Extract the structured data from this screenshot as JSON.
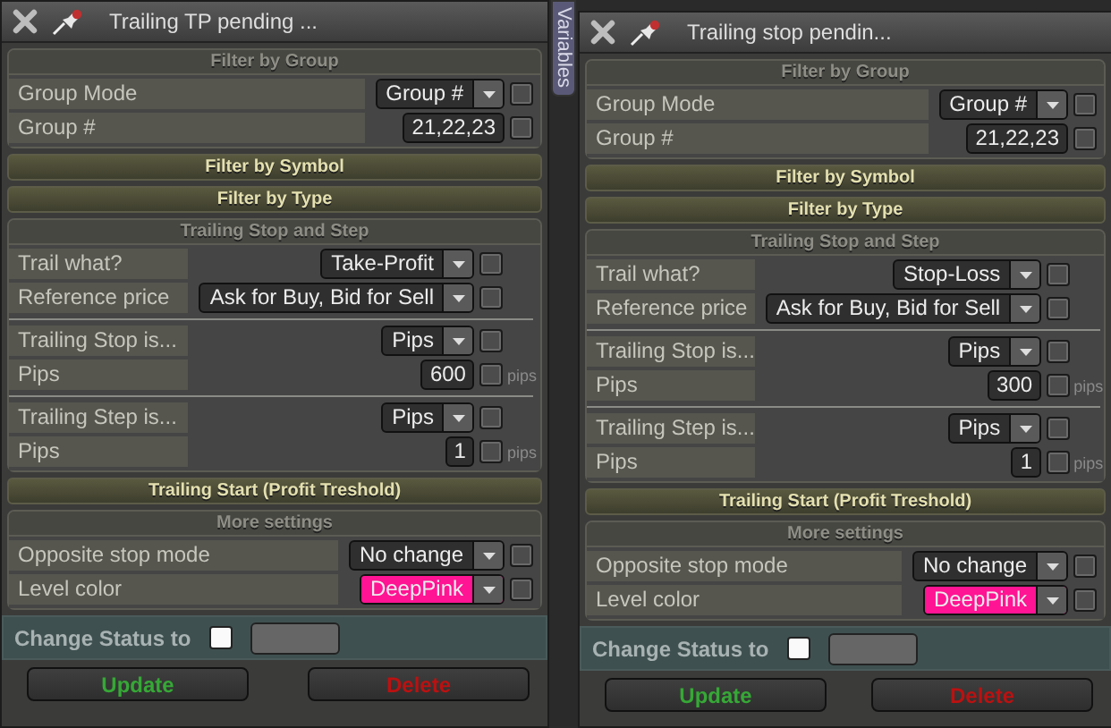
{
  "panels": [
    {
      "title": "Trailing TP pending ...",
      "sections": [
        {
          "title": "Filter by Group",
          "expanded": true,
          "groups": [
            {
              "rows": [
                {
                  "label": "Group Mode",
                  "kind": "dropdown",
                  "value": "Group #",
                  "checked": false
                },
                {
                  "label": "Group #",
                  "kind": "number",
                  "value": "21,22,23",
                  "checked": false
                }
              ]
            }
          ]
        },
        {
          "title": "Filter by Symbol",
          "expanded": false
        },
        {
          "title": "Filter by Type",
          "expanded": false
        },
        {
          "title": "Trailing Stop and Step",
          "expanded": true,
          "groups": [
            {
              "rows": [
                {
                  "label": "Trail what?",
                  "kind": "dropdown",
                  "value": "Take-Profit",
                  "checked": false
                },
                {
                  "label": "Reference price",
                  "kind": "dropdown",
                  "value": "Ask for Buy, Bid for Sell",
                  "checked": false
                }
              ]
            },
            {
              "rows": [
                {
                  "label": "Trailing Stop is...",
                  "kind": "dropdown",
                  "value": "Pips",
                  "checked": false
                },
                {
                  "label": "Pips",
                  "kind": "number",
                  "value": "600",
                  "checked": false,
                  "unit": "pips"
                }
              ]
            },
            {
              "rows": [
                {
                  "label": "Trailing Step is...",
                  "kind": "dropdown",
                  "value": "Pips",
                  "checked": false
                },
                {
                  "label": "Pips",
                  "kind": "number",
                  "value": "1",
                  "checked": false,
                  "unit": "pips"
                }
              ]
            }
          ]
        },
        {
          "title": "Trailing Start (Profit Treshold)",
          "expanded": false
        },
        {
          "title": "More settings",
          "expanded": true,
          "groups": [
            {
              "rows": [
                {
                  "label": "Opposite stop mode",
                  "kind": "dropdown",
                  "value": "No change",
                  "checked": false
                },
                {
                  "label": "Level color",
                  "kind": "dropdown",
                  "value": "DeepPink",
                  "checked": false,
                  "color": "#ff1493"
                }
              ]
            }
          ]
        }
      ],
      "status": {
        "label": "Change Status to",
        "checked": false
      },
      "buttons": [
        {
          "label": "Update",
          "kind": "update"
        },
        {
          "label": "Delete",
          "kind": "delete"
        }
      ]
    },
    {
      "title": "Trailing stop pendin...",
      "sections": [
        {
          "title": "Filter by Group",
          "expanded": true,
          "groups": [
            {
              "rows": [
                {
                  "label": "Group Mode",
                  "kind": "dropdown",
                  "value": "Group #",
                  "checked": false
                },
                {
                  "label": "Group #",
                  "kind": "number",
                  "value": "21,22,23",
                  "checked": false
                }
              ]
            }
          ]
        },
        {
          "title": "Filter by Symbol",
          "expanded": false
        },
        {
          "title": "Filter by Type",
          "expanded": false
        },
        {
          "title": "Trailing Stop and Step",
          "expanded": true,
          "groups": [
            {
              "rows": [
                {
                  "label": "Trail what?",
                  "kind": "dropdown",
                  "value": "Stop-Loss",
                  "checked": false
                },
                {
                  "label": "Reference price",
                  "kind": "dropdown",
                  "value": "Ask for Buy, Bid for Sell",
                  "checked": false
                }
              ]
            },
            {
              "rows": [
                {
                  "label": "Trailing Stop is...",
                  "kind": "dropdown",
                  "value": "Pips",
                  "checked": false
                },
                {
                  "label": "Pips",
                  "kind": "number",
                  "value": "300",
                  "checked": false,
                  "unit": "pips"
                }
              ]
            },
            {
              "rows": [
                {
                  "label": "Trailing Step is...",
                  "kind": "dropdown",
                  "value": "Pips",
                  "checked": false
                },
                {
                  "label": "Pips",
                  "kind": "number",
                  "value": "1",
                  "checked": false,
                  "unit": "pips"
                }
              ]
            }
          ]
        },
        {
          "title": "Trailing Start (Profit Treshold)",
          "expanded": false
        },
        {
          "title": "More settings",
          "expanded": true,
          "groups": [
            {
              "rows": [
                {
                  "label": "Opposite stop mode",
                  "kind": "dropdown",
                  "value": "No change",
                  "checked": false
                },
                {
                  "label": "Level color",
                  "kind": "dropdown",
                  "value": "DeepPink",
                  "checked": false,
                  "color": "#ff1493"
                }
              ]
            }
          ]
        }
      ],
      "status": {
        "label": "Change Status to",
        "checked": false
      },
      "buttons": [
        {
          "label": "Update",
          "kind": "update"
        },
        {
          "label": "Delete",
          "kind": "delete"
        }
      ]
    }
  ],
  "side_tab": {
    "label": "Variables"
  }
}
